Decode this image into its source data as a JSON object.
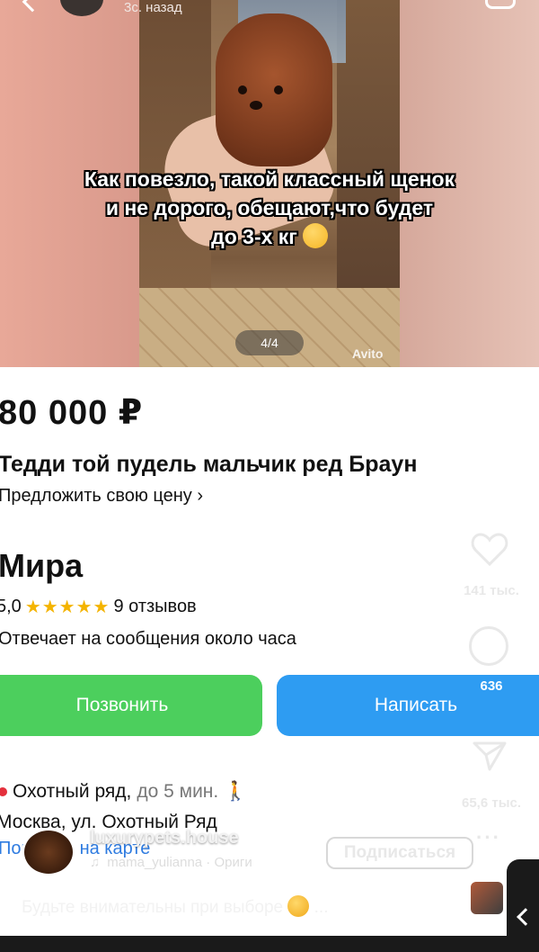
{
  "reel": {
    "time_ago": "3с. назад",
    "caption_line1": "Как повезло, такой классный щенок",
    "caption_line2": "и не дорого, обещают,что будет",
    "caption_line3": "до 3-х кг",
    "pager": "4/4",
    "watermark": "Avito",
    "likes": "141 тыс.",
    "comments": "636",
    "shares": "65,6 тыс.",
    "more": "···",
    "username": "luxurypets.house",
    "audio": "mama_yulianna · Ориги",
    "subscribe_label": "Подписаться",
    "description": "Будьте внимательны при выборе",
    "description_more": "..."
  },
  "listing": {
    "price": "80 000 ₽",
    "title": "Тедди той пудель мальчик ред Браун",
    "offer_price": "Предложить свою цену",
    "seller_name": "Мира",
    "rating": "5,0",
    "stars": "★★★★★",
    "reviews": "9 отзывов",
    "responds": "Отвечает на сообщения около часа",
    "call_label": "Позвонить",
    "write_label": "Написать",
    "metro_station": "Охотный ряд,",
    "metro_time": "до 5 мин.",
    "address": "Москва, ул. Охотный Ряд",
    "map_link": "Показать на карте"
  },
  "colors": {
    "call_green": "#4ccf5d",
    "write_blue": "#2e9cf2",
    "star_gold": "#f4b400",
    "metro_red": "#e4303c",
    "link_blue": "#2e7be0"
  }
}
